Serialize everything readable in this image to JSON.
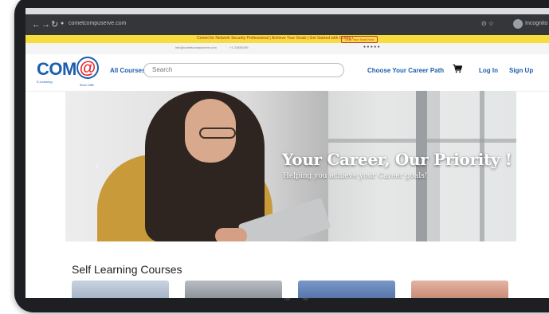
{
  "browser": {
    "url": "cometcompuserve.com",
    "profile_label": "Incognito"
  },
  "promo": {
    "text": "Comet for Network Security Professional | Achieve Your Goals | Get Started with COMET",
    "cta": "Grab Your Seat Now"
  },
  "contact": {
    "email": "info@cometcompuserve.com",
    "phone": "+1 23456789"
  },
  "header": {
    "logo_text": "COM",
    "logo_at": "@",
    "logo_tagline": "E-Learning",
    "logo_since": "Since 1986",
    "all_courses": "All Courses",
    "search_placeholder": "Search",
    "career_path": "Choose Your Career Path",
    "login": "Log In",
    "signup": "Sign Up"
  },
  "hero": {
    "title": "Your Career, Our Priority !",
    "subtitle": "Helping you achieve your Career goals!",
    "prev_icon": "chevron-left-icon",
    "next_icon": "chevron-right-icon"
  },
  "section": {
    "title": "Self Learning Courses"
  },
  "colors": {
    "brand_blue": "#1b5fae",
    "brand_red": "#e8262b",
    "promo_yellow": "#f6dc3c",
    "device_frame": "#1e1f22"
  }
}
